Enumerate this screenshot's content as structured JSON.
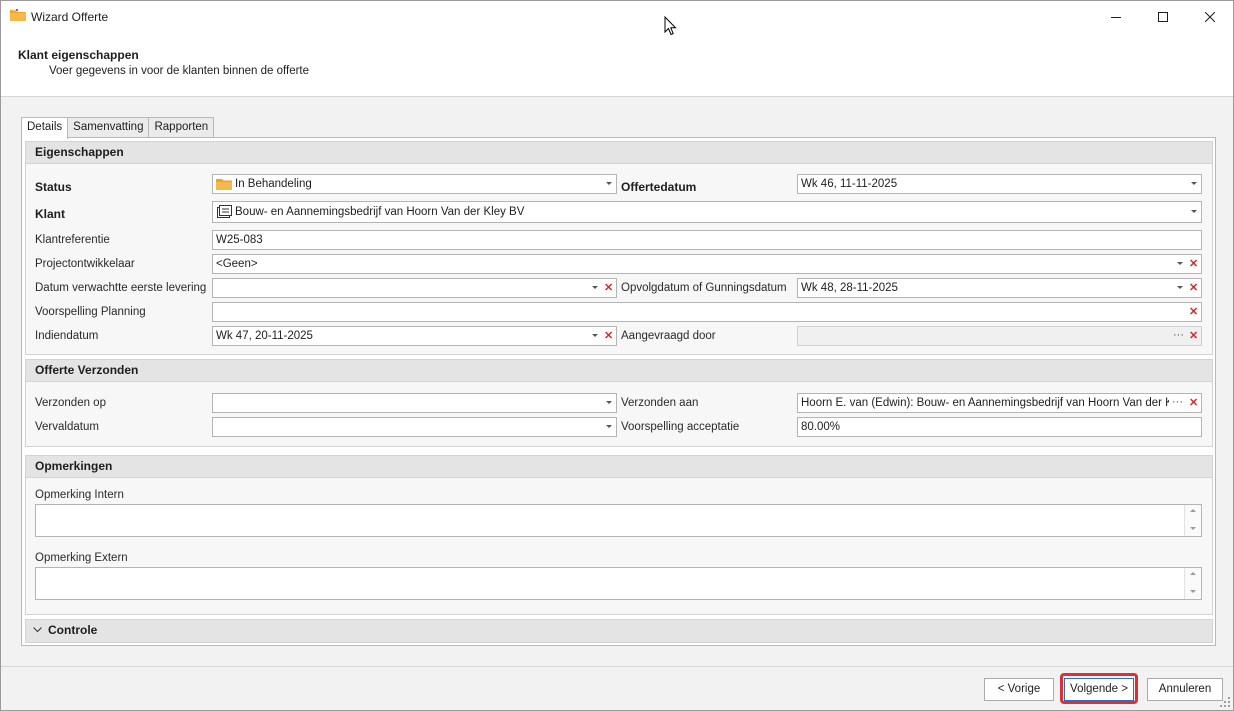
{
  "window": {
    "title": "Wizard Offerte",
    "minimize_icon": "minimize-icon",
    "maximize_icon": "maximize-icon",
    "close_icon": "close-icon"
  },
  "header": {
    "title": "Klant eigenschappen",
    "subtitle": "Voer gegevens in voor de klanten binnen de offerte"
  },
  "tabs": [
    {
      "label": "Details",
      "active": true
    },
    {
      "label": "Samenvatting",
      "active": false
    },
    {
      "label": "Rapporten",
      "active": false
    }
  ],
  "eigenschappen": {
    "title": "Eigenschappen",
    "status": {
      "label": "Status",
      "value": "In Behandeling",
      "icon": "folder-icon"
    },
    "offertedatum": {
      "label": "Offertedatum",
      "value": "Wk 46, 11-11-2025"
    },
    "klant": {
      "label": "Klant",
      "value": "Bouw- en Aannemingsbedrijf van Hoorn Van der Kley BV",
      "icon": "address-card-icon"
    },
    "klantreferentie": {
      "label": "Klantreferentie",
      "value": "W25-083"
    },
    "projectontwikkelaar": {
      "label": "Projectontwikkelaar",
      "value": "<Geen>"
    },
    "datum_levering": {
      "label": "Datum verwachtte eerste levering",
      "value": ""
    },
    "opvolgdatum": {
      "label": "Opvolgdatum of Gunningsdatum",
      "value": "Wk 48, 28-11-2025"
    },
    "voorspelling_planning": {
      "label": "Voorspelling Planning",
      "value": ""
    },
    "indiendatum": {
      "label": "Indiendatum",
      "value": "Wk 47, 20-11-2025"
    },
    "aangevraagd_door": {
      "label": "Aangevraagd door",
      "value": ""
    }
  },
  "verzenden": {
    "title": "Offerte Verzonden",
    "verzonden_op": {
      "label": "Verzonden op",
      "value": ""
    },
    "verzonden_aan": {
      "label": "Verzonden aan",
      "value": "Hoorn E. van (Edwin): Bouw- en Aannemingsbedrijf van Hoorn Van der Kley B"
    },
    "vervaldatum": {
      "label": "Vervaldatum",
      "value": ""
    },
    "voorspelling_acceptatie": {
      "label": "Voorspelling acceptatie",
      "value": "80.00%"
    }
  },
  "opmerkingen": {
    "title": "Opmerkingen",
    "intern": {
      "label": "Opmerking Intern",
      "value": ""
    },
    "extern": {
      "label": "Opmerking Extern",
      "value": ""
    }
  },
  "controle": {
    "title": "Controle",
    "collapsed": true
  },
  "footer": {
    "previous_label": "< Vorige",
    "next_label": "Volgende >",
    "cancel_label": "Annuleren"
  },
  "colors": {
    "highlight": "#d9303a",
    "clear_icon": "#d42a2a",
    "primary_border": "#2f6fb8"
  }
}
